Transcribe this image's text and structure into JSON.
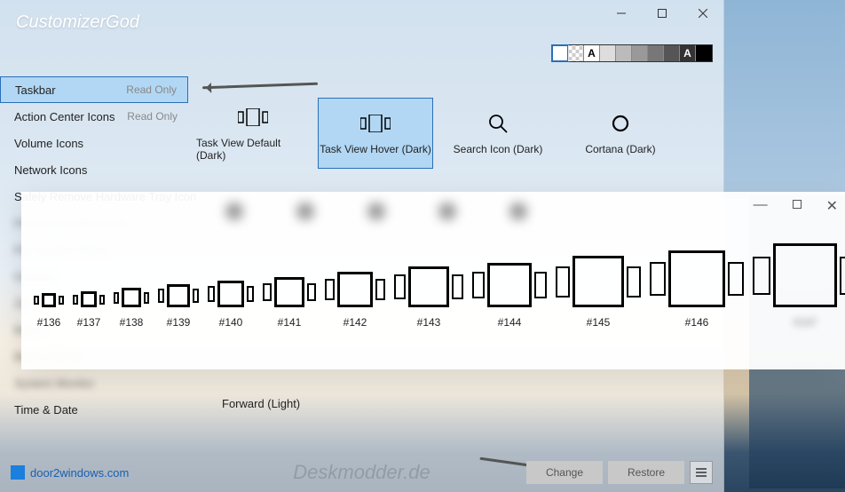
{
  "window": {
    "title": "CustomizerGod"
  },
  "sidebar": {
    "items": [
      {
        "label": "Taskbar",
        "readonly": "Read Only",
        "selected": true
      },
      {
        "label": "Action Center Icons",
        "readonly": "Read Only"
      },
      {
        "label": "Volume Icons"
      },
      {
        "label": "Network Icons"
      },
      {
        "label": "Safely Remove Hardware Tray Icon"
      },
      {
        "label": "File System Hierarchy",
        "blur": true
      },
      {
        "label": "File System Filters",
        "blur": true
      },
      {
        "label": "General",
        "blur": true
      },
      {
        "label": "Zip",
        "blur": true
      },
      {
        "label": "Batch",
        "blur": true
      },
      {
        "label": "Batch Editing",
        "blur": true
      },
      {
        "label": "System Monitor",
        "blur": true
      },
      {
        "label": "Time & Date"
      }
    ]
  },
  "grid": {
    "items": [
      {
        "label": "Task View Default (Dark)",
        "icon": "taskview"
      },
      {
        "label": "Task View Hover (Dark)",
        "icon": "taskview",
        "selected": true
      },
      {
        "label": "Search Icon (Dark)",
        "icon": "search"
      },
      {
        "label": "Cortana (Dark)",
        "icon": "cortana"
      }
    ],
    "lower_label": "Forward (Light)"
  },
  "overlay": {
    "items": [
      {
        "label": "#136",
        "size": 16
      },
      {
        "label": "#137",
        "size": 18
      },
      {
        "label": "#138",
        "size": 22
      },
      {
        "label": "#139",
        "size": 26
      },
      {
        "label": "#140",
        "size": 30
      },
      {
        "label": "#141",
        "size": 34
      },
      {
        "label": "#142",
        "size": 40
      },
      {
        "label": "#143",
        "size": 46
      },
      {
        "label": "#144",
        "size": 50
      },
      {
        "label": "#145",
        "size": 58
      },
      {
        "label": "#146",
        "size": 64
      },
      {
        "label": "#147",
        "size": 72,
        "blur": true
      }
    ]
  },
  "swatches": [
    {
      "bg": "#ffffff",
      "fg": "",
      "sel": true
    },
    {
      "bg": "url",
      "fg": ""
    },
    {
      "bg": "#ffffff",
      "fg": "A"
    },
    {
      "bg": "#dddddd",
      "fg": ""
    },
    {
      "bg": "#bbbbbb",
      "fg": ""
    },
    {
      "bg": "#999999",
      "fg": ""
    },
    {
      "bg": "#777777",
      "fg": ""
    },
    {
      "bg": "#555555",
      "fg": ""
    },
    {
      "bg": "#333333",
      "fg": "A",
      "fgc": "#fff"
    },
    {
      "bg": "#000000",
      "fg": ""
    }
  ],
  "footer": {
    "brand": "door2windows.com",
    "watermark": "Deskmodder.de",
    "change": "Change",
    "restore": "Restore"
  }
}
